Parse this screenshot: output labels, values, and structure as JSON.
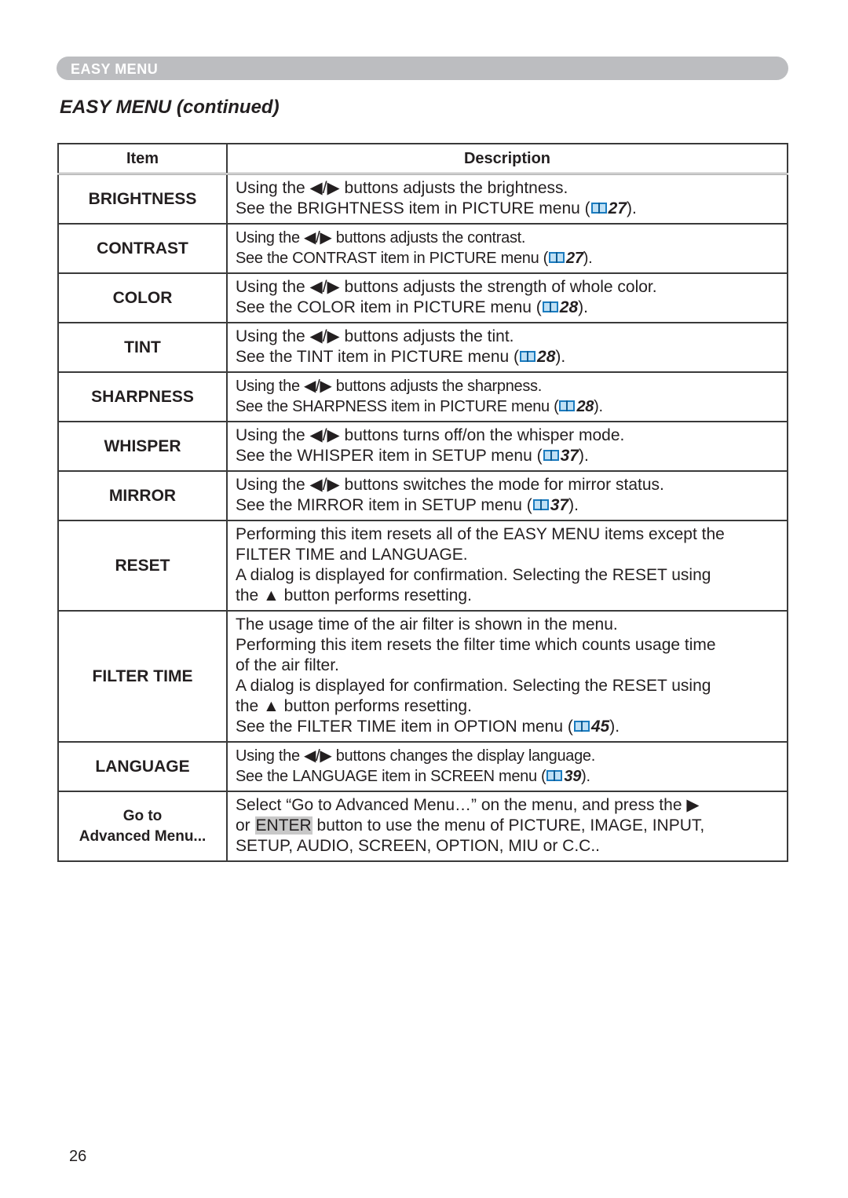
{
  "header": {
    "section_label": "EASY MENU",
    "title": "EASY MENU (continued)"
  },
  "table": {
    "columns": [
      "Item",
      "Description"
    ],
    "rows": [
      {
        "item": "BRIGHTNESS",
        "lines": [
          "Using the ◀/▶ buttons adjusts the brightness."
        ],
        "ref_prefix": "See the BRIGHTNESS item in PICTURE menu (",
        "ref_page": "27",
        "ref_suffix": ")."
      },
      {
        "item": "CONTRAST",
        "lines": [
          "Using the ◀/▶ buttons adjusts the contrast."
        ],
        "ref_prefix": "See the CONTRAST item in PICTURE menu (",
        "ref_page": "27",
        "ref_suffix": ")."
      },
      {
        "item": "COLOR",
        "lines": [
          "Using the ◀/▶ buttons adjusts the strength of whole color."
        ],
        "ref_prefix": "See the COLOR item in PICTURE menu (",
        "ref_page": "28",
        "ref_suffix": ")."
      },
      {
        "item": "TINT",
        "lines": [
          "Using the ◀/▶ buttons adjusts the tint."
        ],
        "ref_prefix": "See the TINT item in PICTURE menu (",
        "ref_page": "28",
        "ref_suffix": ")."
      },
      {
        "item": "SHARPNESS",
        "lines": [
          "Using the ◀/▶ buttons adjusts the sharpness."
        ],
        "ref_prefix": "See the SHARPNESS item in PICTURE menu (",
        "ref_page": "28",
        "ref_suffix": ")."
      },
      {
        "item": "WHISPER",
        "lines": [
          "Using the ◀/▶ buttons turns off/on the whisper mode."
        ],
        "ref_prefix": "See the WHISPER item in SETUP menu (",
        "ref_page": "37",
        "ref_suffix": ")."
      },
      {
        "item": "MIRROR",
        "lines": [
          "Using the ◀/▶ buttons switches the mode for mirror status."
        ],
        "ref_prefix": "See the MIRROR item in SETUP menu (",
        "ref_page": "37",
        "ref_suffix": ")."
      },
      {
        "item": "RESET",
        "lines": [
          "Performing this item resets all of the EASY MENU items except the",
          "FILTER TIME and LANGUAGE.",
          "A dialog is displayed for confirmation. Selecting the RESET using",
          "the ▲ button performs resetting."
        ]
      },
      {
        "item": "FILTER TIME",
        "lines": [
          "The usage time of the air filter is shown in the menu.",
          "Performing this item resets the filter time which counts usage time",
          "of the air filter.",
          "A dialog is displayed for confirmation. Selecting the RESET using",
          "the ▲ button performs resetting."
        ],
        "ref_prefix": "See the FILTER TIME item in OPTION menu (",
        "ref_page": "45",
        "ref_suffix": ")."
      },
      {
        "item": "LANGUAGE",
        "lines": [
          "Using the ◀/▶ buttons changes the display language."
        ],
        "ref_prefix": "See the LANGUAGE item in SCREEN menu (",
        "ref_page": "39",
        "ref_suffix": ")."
      },
      {
        "item_line1": "Go to",
        "item_line2": "Advanced Menu...",
        "line1": "Select “Go to Advanced Menu…” on the menu, and press the ▶",
        "line2_prefix": "or ",
        "line2_key": "ENTER",
        "line2_suffix": " button to use the menu of PICTURE, IMAGE, INPUT,",
        "line3": "SETUP, AUDIO, SCREEN, OPTION, MIU or C.C.."
      }
    ]
  },
  "icons": {
    "reference": "book-icon"
  },
  "colors": {
    "section_bar": "#bcbdc0",
    "book_icon": "#1a7bbf",
    "text": "#231f20"
  },
  "footer": {
    "page_number": "26"
  }
}
